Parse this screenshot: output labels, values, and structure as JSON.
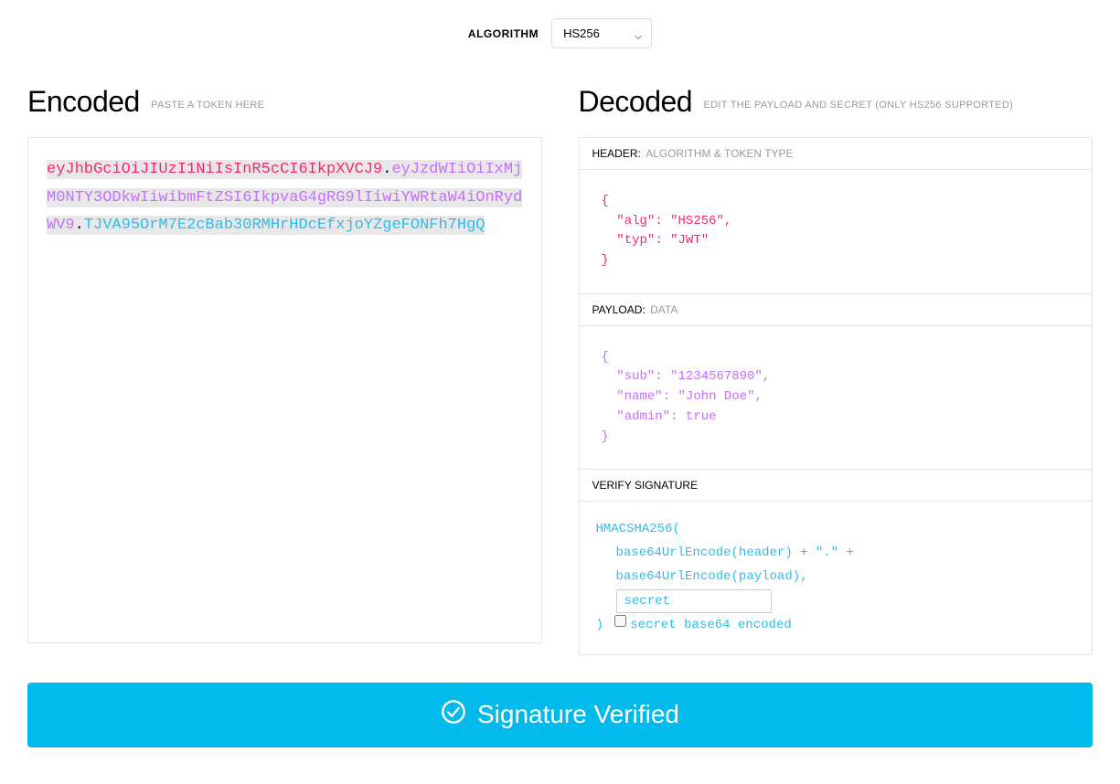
{
  "algorithm": {
    "label": "ALGORITHM",
    "selected": "HS256"
  },
  "encoded": {
    "title": "Encoded",
    "subtitle": "PASTE A TOKEN HERE",
    "token": {
      "header": "eyJhbGciOiJIUzI1NiIsInR5cCI6IkpXVCJ9",
      "payload": "eyJzdWIiOiIxMjM0NTY3ODkwIiwibmFtZSI6IkpvaG4gRG9lIiwiYWRtaW4iOnRydWV9",
      "signature": "TJVA95OrM7E2cBab30RMHrHDcEfxjoYZgeFONFh7HgQ"
    }
  },
  "decoded": {
    "title": "Decoded",
    "subtitle": "EDIT THE PAYLOAD AND SECRET (ONLY HS256 SUPPORTED)",
    "header": {
      "label_main": "HEADER:",
      "label_sub": "ALGORITHM & TOKEN TYPE",
      "json": "{\n  \"alg\": \"HS256\",\n  \"typ\": \"JWT\"\n}"
    },
    "payload": {
      "label_main": "PAYLOAD:",
      "label_sub": "DATA",
      "json": "{\n  \"sub\": \"1234567890\",\n  \"name\": \"John Doe\",\n  \"admin\": true\n}"
    },
    "signature": {
      "label_main": "VERIFY SIGNATURE",
      "fn": "HMACSHA256(",
      "line1": "base64UrlEncode(header) + \".\" +",
      "line2": "base64UrlEncode(payload),",
      "secret_value": "secret",
      "close": ")",
      "checkbox_label": "secret base64 encoded",
      "checkbox_checked": false
    }
  },
  "verify": {
    "text": "Signature Verified"
  }
}
